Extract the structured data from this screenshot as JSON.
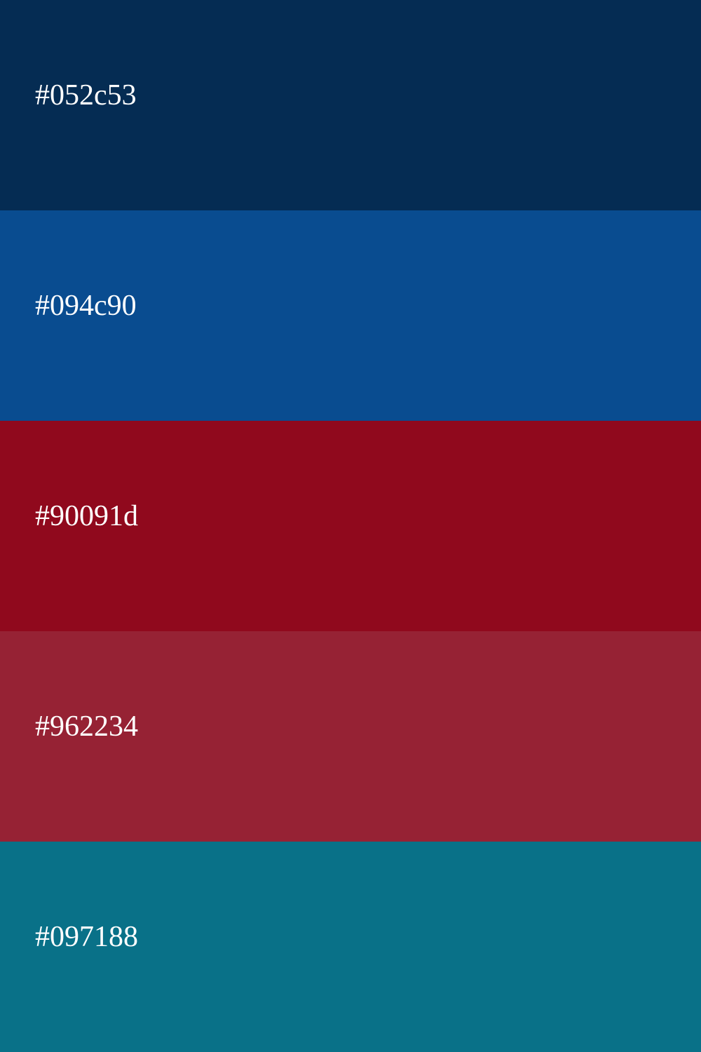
{
  "palette": {
    "swatches": [
      {
        "label": "#052c53",
        "color": "#052c53"
      },
      {
        "label": "#094c90",
        "color": "#094c90"
      },
      {
        "label": "#90091d",
        "color": "#90091d"
      },
      {
        "label": "#962234",
        "color": "#962234"
      },
      {
        "label": "#097188",
        "color": "#097188"
      }
    ]
  }
}
